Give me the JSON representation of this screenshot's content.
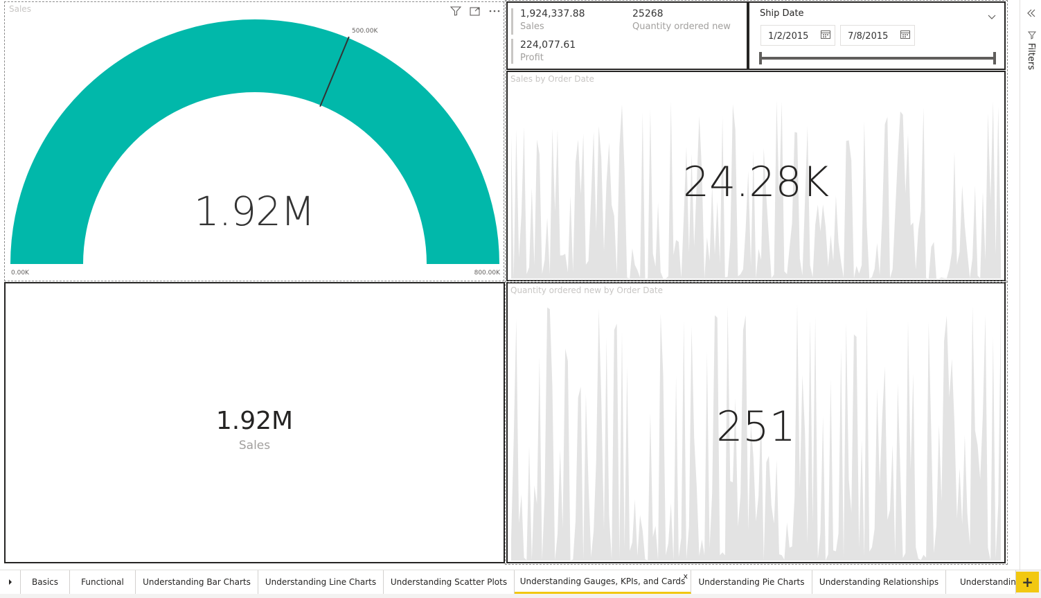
{
  "gauge": {
    "title": "Sales",
    "value_label": "1.92M",
    "min_label": "0.00K",
    "max_label": "800.00K",
    "target_label": "500.00K",
    "fill_fraction": 1.0,
    "target_fraction": 0.625,
    "fill_color": "#01B8AA"
  },
  "card": {
    "value": "1.92M",
    "label": "Sales"
  },
  "multirow_card": {
    "rows": [
      {
        "value": "1,924,337.88",
        "label": "Sales"
      },
      {
        "value": "25268",
        "label": "Quantity ordered new"
      },
      {
        "value": "224,077.61",
        "label": "Profit"
      }
    ]
  },
  "slicer": {
    "title": "Ship Date",
    "start_date": "1/2/2015",
    "end_date": "7/8/2015"
  },
  "sales_chart": {
    "title": "Sales by Order Date",
    "overlay_value": "24.28K"
  },
  "qty_chart": {
    "title": "Quantity ordered new by Order Date",
    "overlay_value": "251"
  },
  "filters_pane": {
    "label": "Filters"
  },
  "tabs": [
    {
      "label": "Basics",
      "active": false
    },
    {
      "label": "Functional",
      "active": false
    },
    {
      "label": "Understanding Bar Charts",
      "active": false
    },
    {
      "label": "Understanding Line Charts",
      "active": false
    },
    {
      "label": "Understanding Scatter Plots",
      "active": false
    },
    {
      "label": "Understanding Gauges, KPIs, and Cards",
      "active": true
    },
    {
      "label": "Understanding Pie Charts",
      "active": false
    },
    {
      "label": "Understanding Relationships",
      "active": false
    },
    {
      "label": "Understanding",
      "active": false
    }
  ],
  "tab_close_glyph": "x",
  "add_tab_glyph": "+",
  "colors": {
    "accent": "#F2C811",
    "gauge": "#01B8AA",
    "area_fill": "#E3E3E3"
  }
}
